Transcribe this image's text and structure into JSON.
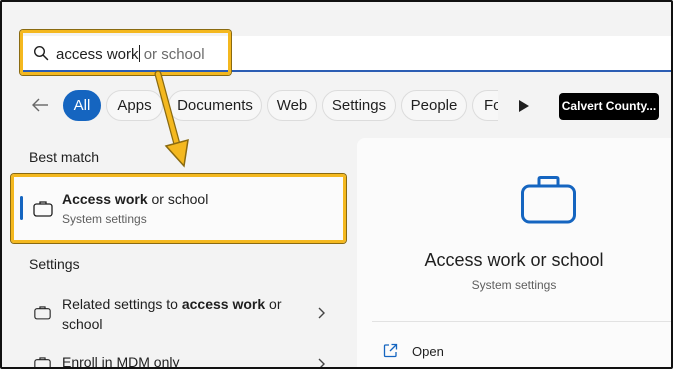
{
  "search": {
    "typed": "access work",
    "suggestion": " or school"
  },
  "filters": {
    "items": [
      "All",
      "Apps",
      "Documents",
      "Web",
      "Settings",
      "People",
      "Fo"
    ],
    "active": "All"
  },
  "account": {
    "label": "Calvert County..."
  },
  "best_match": {
    "section_label": "Best match",
    "title_bold": "Access work",
    "title_rest": " or school",
    "subtitle": "System settings",
    "icon": "briefcase-icon"
  },
  "settings_section": {
    "label": "Settings",
    "items": [
      {
        "line1_prefix": "Related settings to ",
        "line1_bold": "access work",
        "line1_suffix": " or",
        "line2": "school",
        "icon": "briefcase-icon"
      },
      {
        "line1": "Enroll in MDM only",
        "icon": "briefcase-icon"
      }
    ]
  },
  "preview": {
    "title": "Access work or school",
    "subtitle": "System settings",
    "icon": "briefcase-icon",
    "actions": [
      {
        "label": "Open",
        "icon": "open-external-icon"
      }
    ]
  },
  "colors": {
    "accent": "#1565c0",
    "highlight": "#f4b81f",
    "background": "#f3f3f3"
  }
}
